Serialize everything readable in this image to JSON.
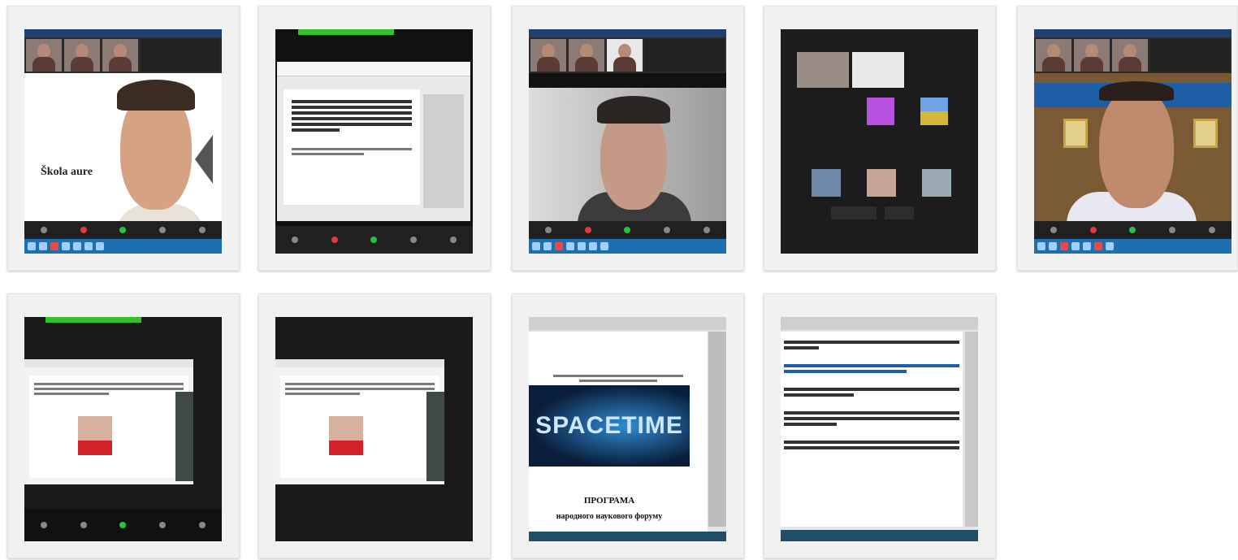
{
  "thumbnails": [
    {
      "id": "t1",
      "caption": "Škola aure"
    },
    {
      "id": "t2"
    },
    {
      "id": "t3"
    },
    {
      "id": "t4"
    },
    {
      "id": "t5"
    },
    {
      "id": "t6"
    },
    {
      "id": "t7"
    },
    {
      "id": "t8",
      "banner": "SPACETIME",
      "heading": "ПРОГРАМА",
      "subheading": "народного наукового форуму"
    },
    {
      "id": "t9"
    }
  ],
  "colors": {
    "zoom_green": "#35c12b",
    "taskbar_blue": "#1d6fb0",
    "dark": "#1e1e1e"
  }
}
